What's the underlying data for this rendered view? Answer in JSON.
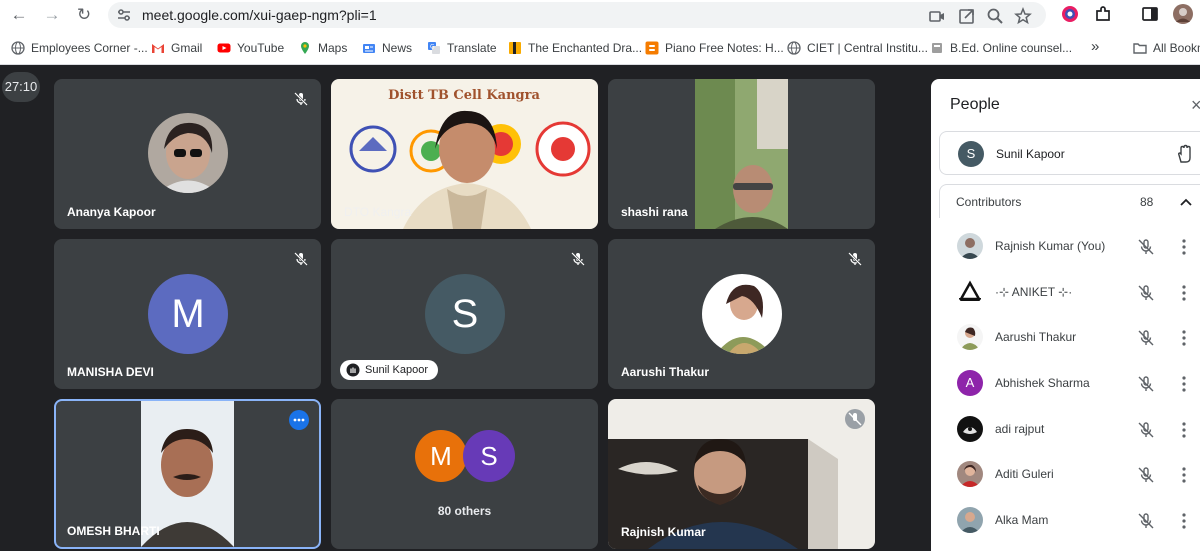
{
  "browser": {
    "url": "meet.google.com/xui-gaep-ngm?pli=1",
    "bookmarks": [
      {
        "label": "Employees Corner -...",
        "icon": "globe-icon"
      },
      {
        "label": "Gmail",
        "icon": "gmail-icon"
      },
      {
        "label": "YouTube",
        "icon": "youtube-icon"
      },
      {
        "label": "Maps",
        "icon": "maps-icon"
      },
      {
        "label": "News",
        "icon": "news-icon"
      },
      {
        "label": "Translate",
        "icon": "translate-icon"
      },
      {
        "label": "The Enchanted Dra...",
        "icon": "book-icon"
      },
      {
        "label": "Piano Free Notes: H...",
        "icon": "blogger-icon"
      },
      {
        "label": "CIET | Central Institu...",
        "icon": "globe-icon"
      },
      {
        "label": "B.Ed. Online counsel...",
        "icon": "site-icon"
      }
    ],
    "overflow_label": "»",
    "all_bookmarks_label": "All Bookm"
  },
  "meet": {
    "timer": "27:10",
    "tiles": [
      {
        "name": "Ananya Kapoor",
        "kind": "photo",
        "muted": true
      },
      {
        "name": "DTO Kangra",
        "kind": "video",
        "banner": "Distt TB Cell Kangra",
        "muted": false
      },
      {
        "name": "shashi rana",
        "kind": "video",
        "muted": false
      },
      {
        "name": "MANISHA DEVI",
        "kind": "avatar",
        "letter": "M",
        "color": "#5c6bc0",
        "muted": true
      },
      {
        "name": "Sunil Kapoor",
        "kind": "avatar",
        "letter": "S",
        "color": "#455a64",
        "muted": true,
        "chip": true
      },
      {
        "name": "Aarushi Thakur",
        "kind": "photo",
        "muted": true
      },
      {
        "name": "OMESH BHARTI",
        "kind": "video",
        "muted": false,
        "active": true
      },
      {
        "name": "80 others",
        "kind": "group",
        "letters": [
          "M",
          "S"
        ],
        "colors": [
          "#e8710a",
          "#673ab7"
        ]
      },
      {
        "name": "Rajnish Kumar",
        "kind": "video",
        "muted": true
      }
    ]
  },
  "people": {
    "title": "People",
    "close": "×",
    "host": {
      "letter": "S",
      "name": "Sunil Kapoor"
    },
    "section_title": "Contributors",
    "count": "88",
    "list": [
      {
        "name": "Rajnish Kumar (You)",
        "avatar": "photo",
        "color": "#9e9e9e"
      },
      {
        "name": "·⊹ ANIKET ⊹·",
        "avatar": "logo",
        "color": "#ffffff"
      },
      {
        "name": "Aarushi Thakur",
        "avatar": "photo",
        "color": "#8d6e63"
      },
      {
        "name": "Abhishek Sharma",
        "avatar": "letter",
        "letter": "A",
        "color": "#8e24aa"
      },
      {
        "name": "adi rajput",
        "avatar": "photo",
        "color": "#212121"
      },
      {
        "name": "Aditi Guleri",
        "avatar": "photo",
        "color": "#a1887f"
      },
      {
        "name": "Alka Mam",
        "avatar": "photo",
        "color": "#90a4ae"
      }
    ]
  }
}
